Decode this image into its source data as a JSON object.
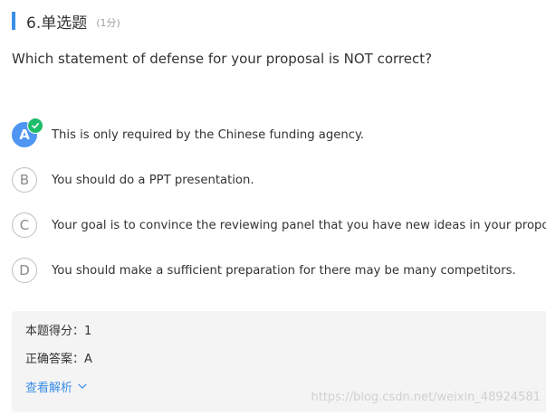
{
  "question": {
    "number_label": "6.单选题",
    "score_label": "(1分)",
    "text": "Which statement of defense for your proposal is NOT correct?",
    "accent_color": "#3a8ee6"
  },
  "options": [
    {
      "letter": "A",
      "text": "This is only required by the Chinese funding agency.",
      "selected": true
    },
    {
      "letter": "B",
      "text": "You should do a PPT presentation.",
      "selected": false
    },
    {
      "letter": "C",
      "text": "Your goal is to convince the reviewing panel that you have new ideas in your proposal.",
      "selected": false
    },
    {
      "letter": "D",
      "text": "You should make a sufficient preparation for there may be many competitors.",
      "selected": false
    }
  ],
  "result": {
    "score_label": "本题得分：",
    "score_value": "1",
    "answer_label": "正确答案：",
    "answer_value": "A",
    "analysis_link": "查看解析",
    "link_icon": "chevron-down-icon"
  },
  "watermark": "https://blog.csdn.net/weixin_48924581",
  "colors": {
    "selected_option": "#4f95f2",
    "correct_badge": "#1ebc6b",
    "result_background": "#f4f4f5",
    "link": "#3a8ee6"
  }
}
